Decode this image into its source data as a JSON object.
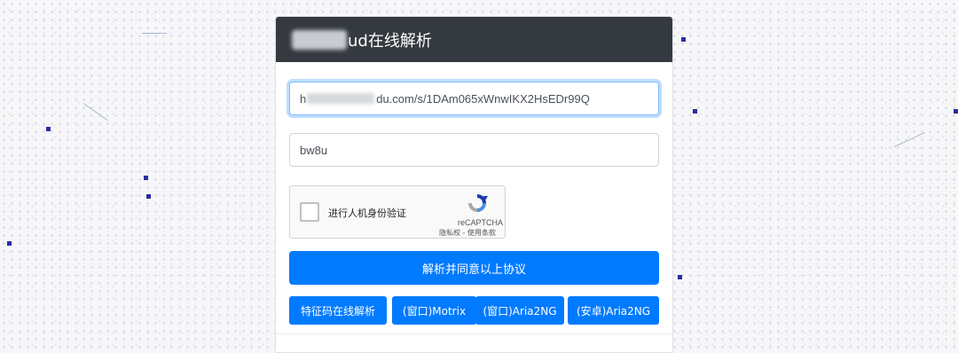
{
  "header": {
    "title": "ud在线解析"
  },
  "form": {
    "url_value": "du.com/s/1DAm065xWnwIKX2HsEDr99Q",
    "url_prefix": "h",
    "code_value": "bw8u"
  },
  "captcha": {
    "label": "进行人机身份验证",
    "brand": "reCAPTCHA",
    "links": "隐私权 - 使用条款"
  },
  "buttons": {
    "parse": "解析并同意以上协议",
    "feature_code": "特征码在线解析",
    "motrix": "(窗口)Motrix",
    "aria2ng_window": "(窗口)Aria2NG",
    "aria2ng_android": "(安卓)Aria2NG"
  },
  "colors": {
    "header_bg": "#343a40",
    "primary": "#007bff"
  }
}
